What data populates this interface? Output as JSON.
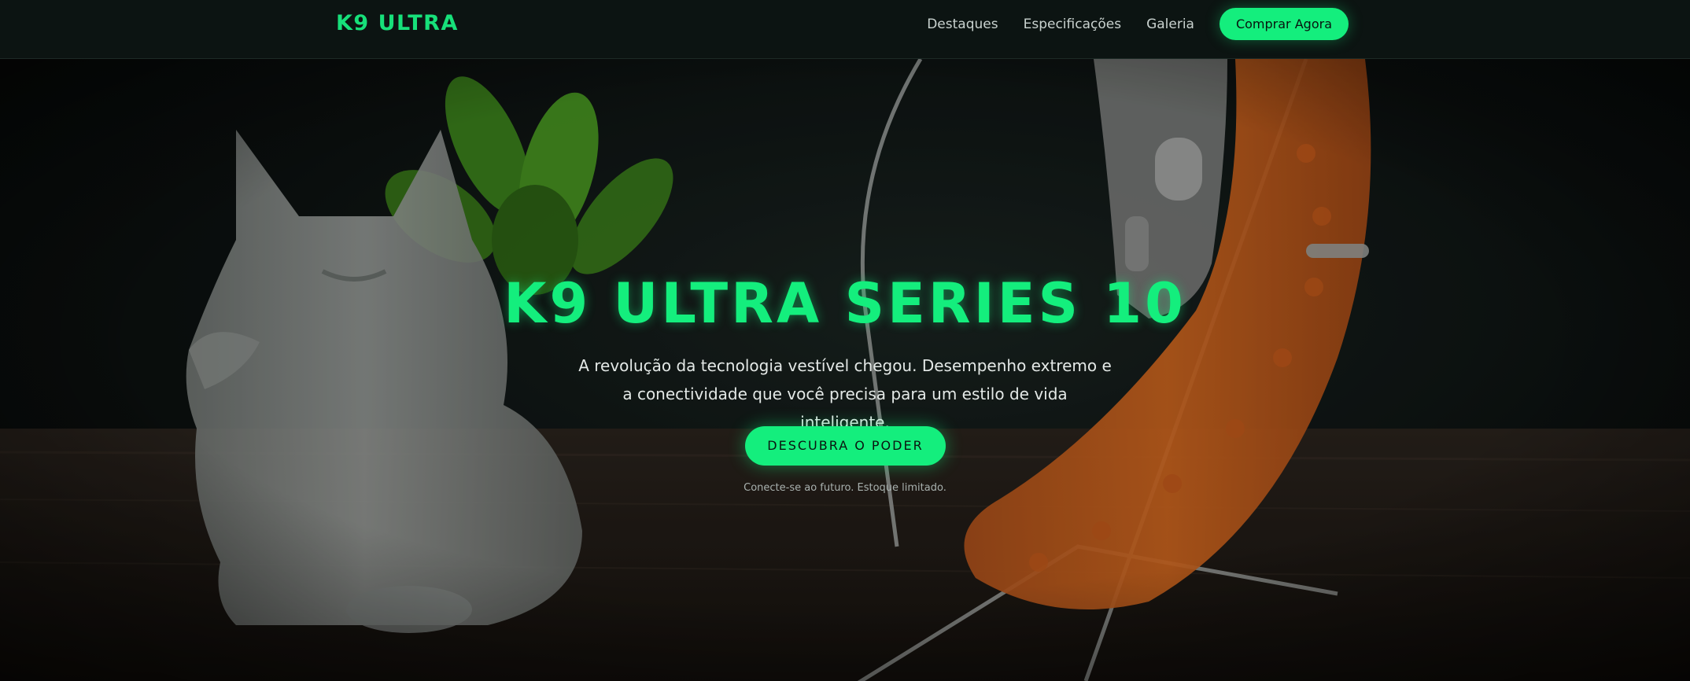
{
  "navbar": {
    "brand": "K9 ULTRA",
    "links": [
      {
        "label": "Destaques"
      },
      {
        "label": "Especificações"
      },
      {
        "label": "Galeria"
      }
    ],
    "cta_label": "Comprar Agora"
  },
  "hero": {
    "title": "K9 ULTRA SERIES 10",
    "description": "A revolução da tecnologia vestível chegou. Desempenho extremo e a conectividade que você precisa para um estilo de vida inteligente.",
    "cta_label": "DESCUBRA O PODER",
    "note": "Conecte-se ao futuro. Estoque limitado."
  },
  "colors": {
    "accent": "#14ee7d",
    "nav_background": "#0c1412",
    "hero_background": "#0b0f0e"
  }
}
